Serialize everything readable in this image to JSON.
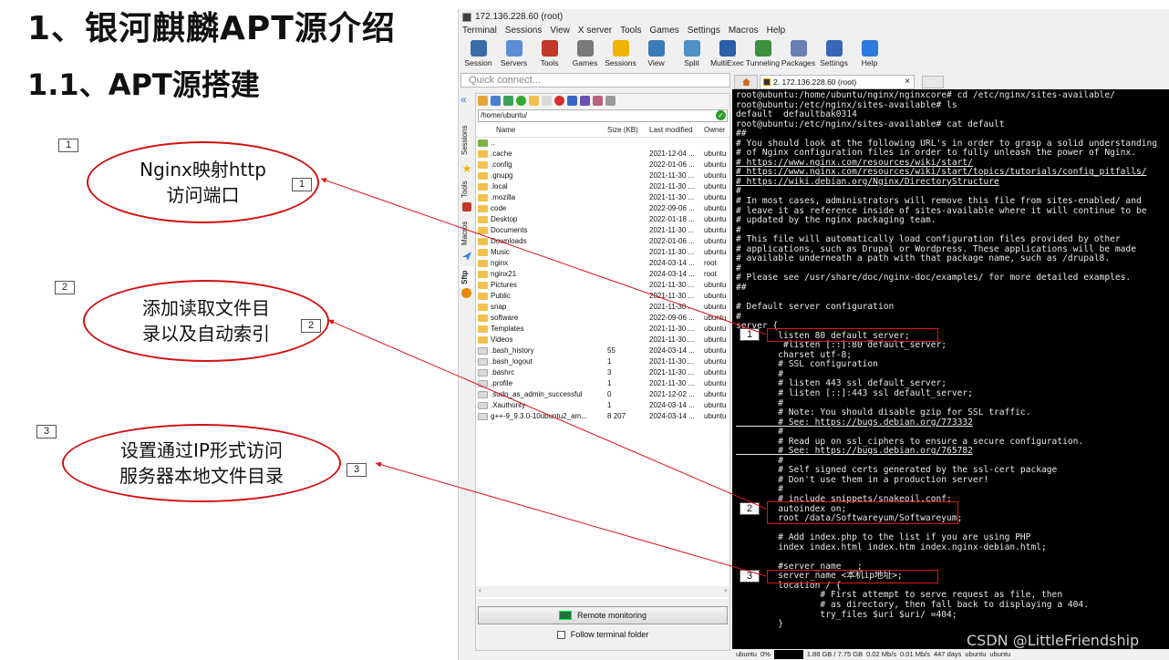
{
  "slide": {
    "title": "1、银河麒麟APT源介绍",
    "subtitle": "1.1、APT源搭建",
    "callouts": [
      {
        "num": "1",
        "line1": "Nginx映射http",
        "line2": "访问端口"
      },
      {
        "num": "2",
        "line1": "添加读取文件目",
        "line2": "录以及自动索引"
      },
      {
        "num": "3",
        "line1": "设置通过IP形式访问",
        "line2": "服务器本地文件目录"
      }
    ]
  },
  "window": {
    "title": "172.136.228.60 (root)",
    "menu": [
      "Terminal",
      "Sessions",
      "View",
      "X server",
      "Tools",
      "Games",
      "Settings",
      "Macros",
      "Help"
    ],
    "toolbar": [
      {
        "label": "Session",
        "icon": "session-icon",
        "color": "#3b6ea8"
      },
      {
        "label": "Servers",
        "icon": "servers-icon",
        "color": "#5a8fd6"
      },
      {
        "label": "Tools",
        "icon": "tools-icon",
        "color": "#c0392b"
      },
      {
        "label": "Games",
        "icon": "games-icon",
        "color": "#7a7a7a"
      },
      {
        "label": "Sessions",
        "icon": "sessions-star-icon",
        "color": "#f1b400"
      },
      {
        "label": "View",
        "icon": "view-icon",
        "color": "#3d7ab8"
      },
      {
        "label": "Split",
        "icon": "split-icon",
        "color": "#4f8fc8"
      },
      {
        "label": "MultiExec",
        "icon": "multiexec-icon",
        "color": "#2c5fa8"
      },
      {
        "label": "Tunneling",
        "icon": "tunneling-icon",
        "color": "#3f8f3f"
      },
      {
        "label": "Packages",
        "icon": "packages-icon",
        "color": "#6a7fb8"
      },
      {
        "label": "Settings",
        "icon": "settings-icon",
        "color": "#3a66b8"
      },
      {
        "label": "Help",
        "icon": "help-icon",
        "color": "#2e7be0"
      }
    ],
    "quick_connect_placeholder": "Quick connect...",
    "side_tabs": [
      "Sessions",
      "Tools",
      "Macros",
      "Sftp"
    ],
    "sftp": {
      "path": "/home/ubuntu/",
      "columns": [
        "Name",
        "Size (KB)",
        "Last modified",
        "Owner"
      ],
      "files": [
        {
          "name": "..",
          "size": "",
          "modified": "",
          "owner": "",
          "type": "up"
        },
        {
          "name": ".cache",
          "size": "",
          "modified": "2021-12-04 ...",
          "owner": "ubuntu",
          "type": "folder"
        },
        {
          "name": ".config",
          "size": "",
          "modified": "2022-01-06 ...",
          "owner": "ubuntu",
          "type": "folder"
        },
        {
          "name": ".gnupg",
          "size": "",
          "modified": "2021-11-30 ...",
          "owner": "ubuntu",
          "type": "folder"
        },
        {
          "name": ".local",
          "size": "",
          "modified": "2021-11-30 ...",
          "owner": "ubuntu",
          "type": "folder"
        },
        {
          "name": ".mozilla",
          "size": "",
          "modified": "2021-11-30 ...",
          "owner": "ubuntu",
          "type": "folder"
        },
        {
          "name": "code",
          "size": "",
          "modified": "2022-09-06 ...",
          "owner": "ubuntu",
          "type": "folder"
        },
        {
          "name": "Desktop",
          "size": "",
          "modified": "2022-01-18 ...",
          "owner": "ubuntu",
          "type": "folder"
        },
        {
          "name": "Documents",
          "size": "",
          "modified": "2021-11-30 ...",
          "owner": "ubuntu",
          "type": "folder"
        },
        {
          "name": "Downloads",
          "size": "",
          "modified": "2022-01-06 ...",
          "owner": "ubuntu",
          "type": "folder"
        },
        {
          "name": "Music",
          "size": "",
          "modified": "2021-11-30 ...",
          "owner": "ubuntu",
          "type": "folder"
        },
        {
          "name": "nginx",
          "size": "",
          "modified": "2024-03-14 ...",
          "owner": "root",
          "type": "folder"
        },
        {
          "name": "nginx21",
          "size": "",
          "modified": "2024-03-14 ...",
          "owner": "root",
          "type": "folder"
        },
        {
          "name": "Pictures",
          "size": "",
          "modified": "2021-11-30 ...",
          "owner": "ubuntu",
          "type": "folder"
        },
        {
          "name": "Public",
          "size": "",
          "modified": "2021-11-30 ...",
          "owner": "ubuntu",
          "type": "folder"
        },
        {
          "name": "snap",
          "size": "",
          "modified": "2021-11-30 ...",
          "owner": "ubuntu",
          "type": "folder"
        },
        {
          "name": "software",
          "size": "",
          "modified": "2022-09-06 ...",
          "owner": "ubuntu",
          "type": "folder"
        },
        {
          "name": "Templates",
          "size": "",
          "modified": "2021-11-30 ...",
          "owner": "ubuntu",
          "type": "folder"
        },
        {
          "name": "Videos",
          "size": "",
          "modified": "2021-11-30 ...",
          "owner": "ubuntu",
          "type": "folder"
        },
        {
          "name": ".bash_history",
          "size": "55",
          "modified": "2024-03-14 ...",
          "owner": "ubuntu",
          "type": "file"
        },
        {
          "name": ".bash_logout",
          "size": "1",
          "modified": "2021-11-30 ...",
          "owner": "ubuntu",
          "type": "file"
        },
        {
          "name": ".bashrc",
          "size": "3",
          "modified": "2021-11-30 ...",
          "owner": "ubuntu",
          "type": "file"
        },
        {
          "name": ".profile",
          "size": "1",
          "modified": "2021-11-30 ...",
          "owner": "ubuntu",
          "type": "file"
        },
        {
          "name": ".sudo_as_admin_successful",
          "size": "0",
          "modified": "2021-12-02 ...",
          "owner": "ubuntu",
          "type": "file"
        },
        {
          "name": ".Xauthority",
          "size": "1",
          "modified": "2024-03-14 ...",
          "owner": "ubuntu",
          "type": "file"
        },
        {
          "name": "g++-9_9.3.0-10ubuntu2_am...",
          "size": "8 207",
          "modified": "2024-03-14 ...",
          "owner": "ubuntu",
          "type": "file"
        }
      ],
      "remote_monitoring": "Remote monitoring",
      "follow_terminal": "Follow terminal folder"
    },
    "terminal_tab": "2. 172.136.228.60 (root)",
    "terminal_lines": [
      "root@ubuntu:/home/ubuntu/nginx/nginxcore# cd /etc/nginx/sites-available/",
      "root@ubuntu:/etc/nginx/sites-available# ls",
      "default  defaultbak0314",
      "root@ubuntu:/etc/nginx/sites-available# cat default",
      "##",
      "# You should look at the following URL's in order to grasp a solid understanding",
      "# of Nginx configuration files in order to fully unleash the power of Nginx.",
      "# https://www.nginx.com/resources/wiki/start/",
      "# https://www.nginx.com/resources/wiki/start/topics/tutorials/config_pitfalls/",
      "# https://wiki.debian.org/Nginx/DirectoryStructure",
      "#",
      "# In most cases, administrators will remove this file from sites-enabled/ and",
      "# leave it as reference inside of sites-available where it will continue to be",
      "# updated by the nginx packaging team.",
      "#",
      "# This file will automatically load configuration files provided by other",
      "# applications, such as Drupal or Wordpress. These applications will be made",
      "# available underneath a path with that package name, such as /drupal8.",
      "#",
      "# Please see /usr/share/doc/nginx-doc/examples/ for more detailed examples.",
      "##",
      "",
      "# Default server configuration",
      "#",
      "server {",
      "        listen 80 default_server;",
      "         #listen [::]:80 default_server;",
      "        charset utf-8;",
      "        # SSL configuration",
      "        #",
      "        # listen 443 ssl default_server;",
      "        # listen [::]:443 ssl default_server;",
      "        #",
      "        # Note: You should disable gzip for SSL traffic.",
      "        # See: https://bugs.debian.org/773332",
      "        #",
      "        # Read up on ssl_ciphers to ensure a secure configuration.",
      "        # See: https://bugs.debian.org/765782",
      "        #",
      "        # Self signed certs generated by the ssl-cert package",
      "        # Don't use them in a production server!",
      "        #",
      "        # include snippets/snakeoil.conf;",
      "        autoindex on;",
      "        root /data/Softwareyum/Softwareyum;",
      "",
      "        # Add index.php to the list if you are using PHP",
      "        index index.html index.htm index.nginx-debian.html;",
      "",
      "        #server_name  _;",
      "        server_name <本机ip地址>;",
      "        location / {",
      "                # First attempt to serve request as file, then",
      "                # as directory, then fall back to displaying a 404.",
      "                try_files $uri $uri/ =404;",
      "        }"
    ],
    "status_bar": [
      "ubuntu",
      "0%",
      "1.88 GB / 7.75 GB",
      "0.02 Mb/s",
      "0.01 Mb/s",
      "447 days",
      "ubuntu",
      "ubuntu"
    ],
    "terminal_markers": [
      "1",
      "2",
      "3"
    ]
  },
  "watermark": "CSDN @LittleFriendship"
}
